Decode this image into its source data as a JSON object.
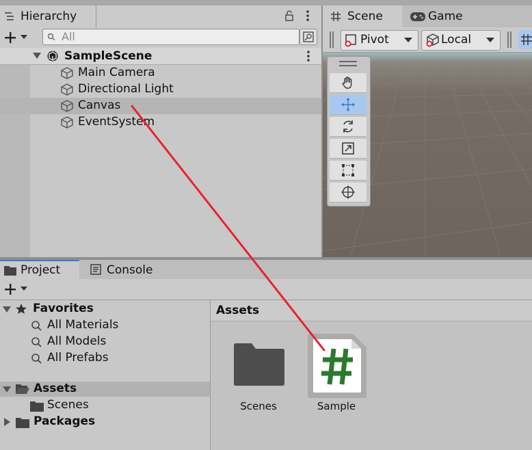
{
  "hierarchy": {
    "tab_label": "Hierarchy",
    "search_placeholder": "All",
    "scene_name": "SampleScene",
    "items": [
      {
        "label": "Main Camera"
      },
      {
        "label": "Directional Light"
      },
      {
        "label": "Canvas"
      },
      {
        "label": "EventSystem"
      }
    ]
  },
  "scene": {
    "tabs": [
      {
        "label": "Scene"
      },
      {
        "label": "Game"
      }
    ],
    "pivot_label": "Pivot",
    "local_label": "Local",
    "tools": [
      "hand-tool",
      "move-tool",
      "rotate-tool",
      "scale-tool",
      "rect-tool",
      "transform-tool"
    ],
    "active_tool": "move-tool"
  },
  "project": {
    "tabs": [
      {
        "label": "Project"
      },
      {
        "label": "Console"
      }
    ],
    "favorites_label": "Favorites",
    "favorites": [
      {
        "label": "All Materials"
      },
      {
        "label": "All Models"
      },
      {
        "label": "All Prefabs"
      }
    ],
    "assets_label": "Assets",
    "assets_children": [
      {
        "label": "Scenes"
      }
    ],
    "packages_label": "Packages",
    "assets_header": "Assets",
    "asset_items": [
      {
        "label": "Scenes",
        "icon": "folder-icon"
      },
      {
        "label": "Sample",
        "icon": "csharp-script-icon"
      }
    ]
  },
  "annotation": {
    "arrow_color": "#e8232d",
    "from": "Canvas",
    "to": "Sample"
  },
  "colors": {
    "selection": "#a9c8ef",
    "project_tab_accent": "#3a79d9",
    "script_hash": "#2b7a2e"
  }
}
